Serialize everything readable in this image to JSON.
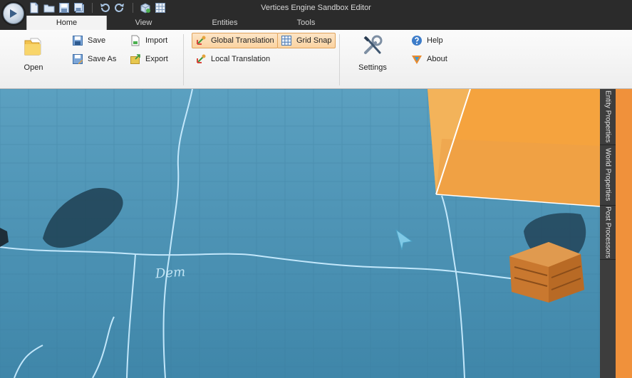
{
  "window": {
    "title": "Vertices Engine Sandbox Editor"
  },
  "tabs": [
    {
      "label": "Home",
      "active": true
    },
    {
      "label": "View",
      "active": false
    },
    {
      "label": "Entities",
      "active": false
    },
    {
      "label": "Tools",
      "active": false
    }
  ],
  "ribbon": {
    "file": {
      "open": "Open",
      "save": "Save",
      "save_as": "Save As",
      "import": "Import",
      "export": "Export"
    },
    "transform": {
      "global_translation": "Global Translation",
      "local_translation": "Local Translation",
      "grid_snap": "Grid Snap"
    },
    "misc": {
      "settings": "Settings",
      "help": "Help",
      "about": "About"
    }
  },
  "viewport": {
    "floor_text": "Dem"
  },
  "side_panel": {
    "tabs": [
      "Entity Properties",
      "World Properties",
      "Post Processors"
    ]
  },
  "colors": {
    "accent": "#f0913b",
    "floor": "#4d93b5",
    "titlebar": "#2b2b2b",
    "ribbon": "#f3f3f3"
  },
  "icons": {
    "app": "play-icon",
    "new": "new-file-icon",
    "open": "folder-icon",
    "save": "floppy-disk-icon",
    "save_all": "save-all-icon",
    "undo": "undo-icon",
    "redo": "redo-icon",
    "add_entity": "package-icon",
    "grid": "grid-icon",
    "import": "import-icon",
    "export": "export-icon",
    "translate": "move-gizmo-icon",
    "settings": "wrench-screwdriver-icon",
    "help": "question-icon",
    "about": "vertices-logo-icon"
  }
}
